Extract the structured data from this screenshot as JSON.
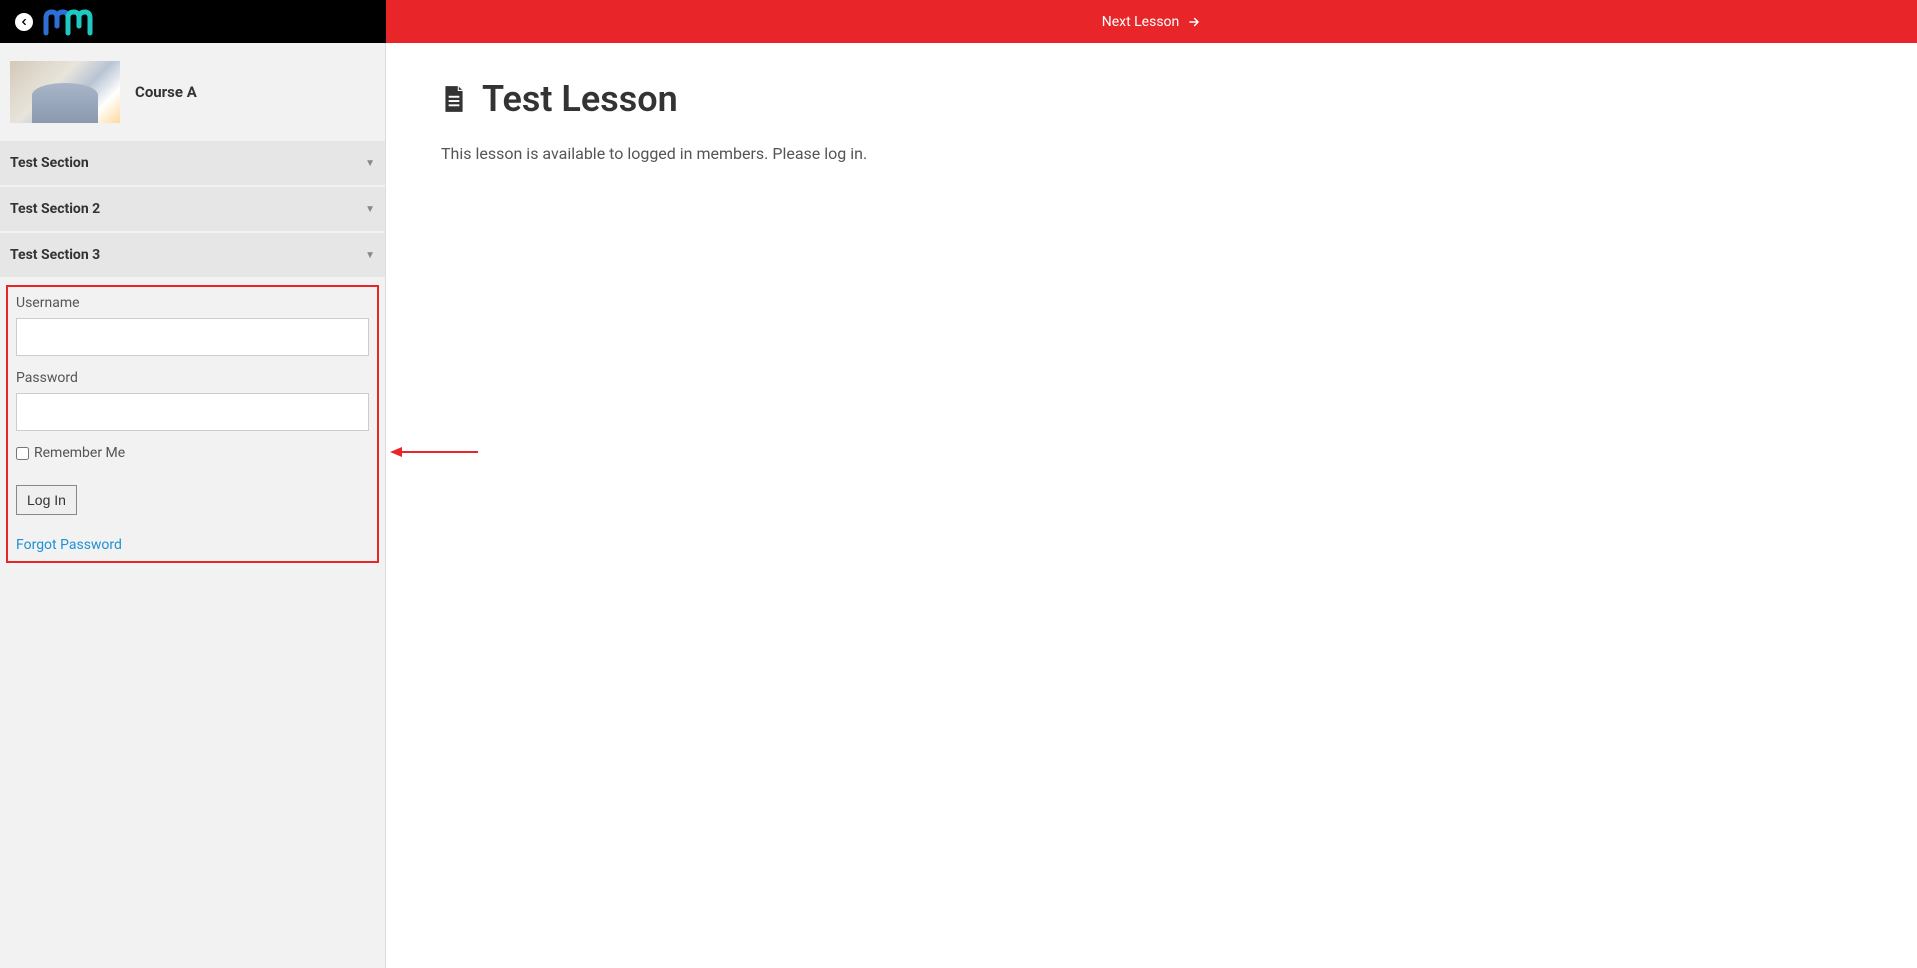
{
  "header": {
    "next_lesson_label": "Next Lesson"
  },
  "sidebar": {
    "course_title": "Course A",
    "sections": [
      {
        "label": "Test Section"
      },
      {
        "label": "Test Section 2"
      },
      {
        "label": "Test Section 3"
      }
    ],
    "login_form": {
      "username_label": "Username",
      "username_value": "",
      "password_label": "Password",
      "password_value": "",
      "remember_me_label": "Remember Me",
      "login_button_label": "Log In",
      "forgot_password_label": "Forgot Password"
    }
  },
  "content": {
    "lesson_title": "Test Lesson",
    "lesson_message": "This lesson is available to logged in members. Please log in."
  },
  "colors": {
    "accent": "#e8262a",
    "link": "#1e90d4"
  }
}
